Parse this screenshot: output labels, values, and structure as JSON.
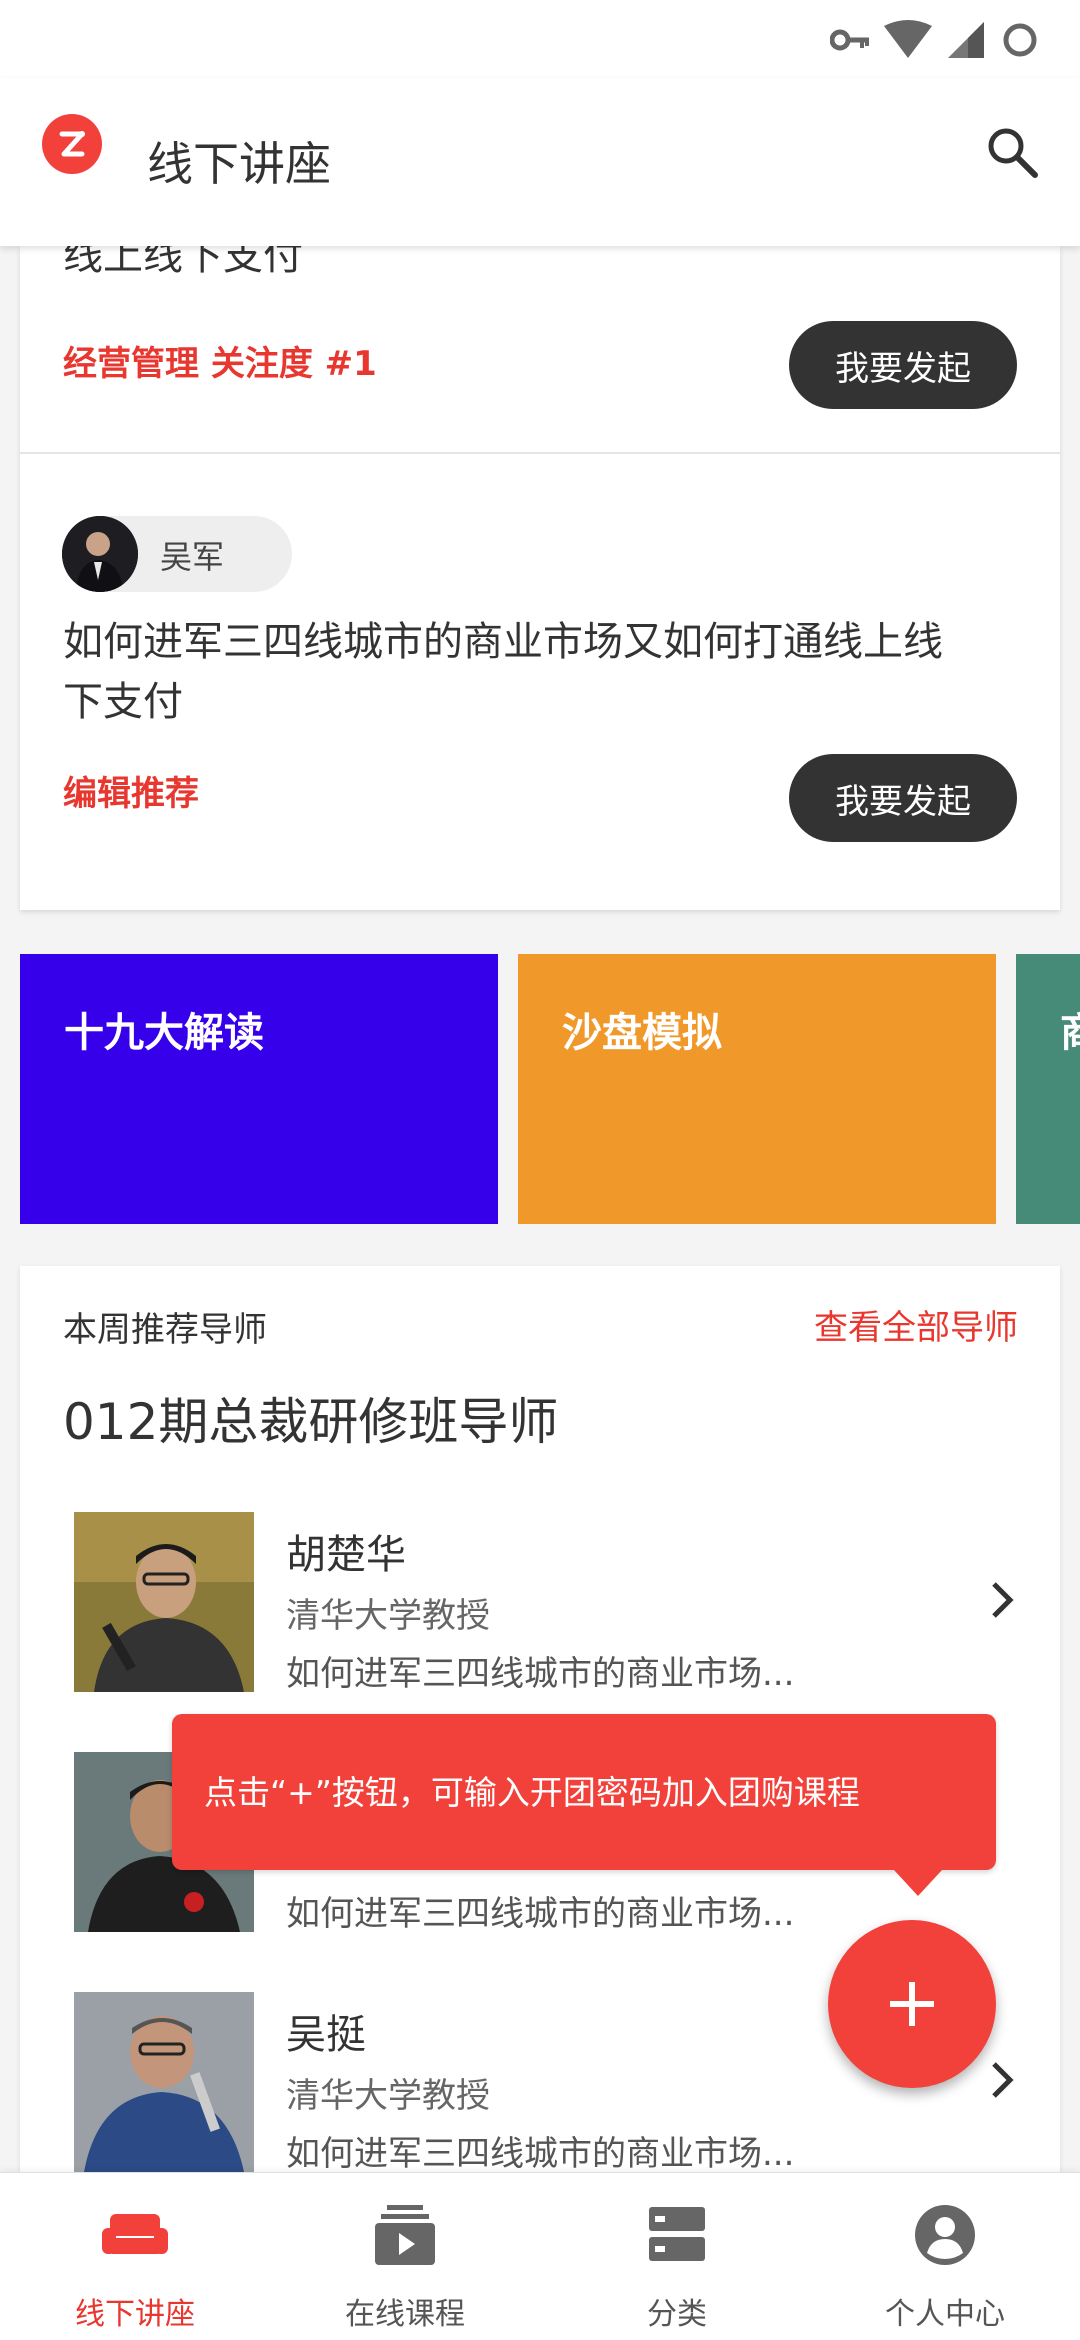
{
  "app": {
    "title": "线下讲座"
  },
  "top_card": {
    "clipped_text": "线上线下支付",
    "tag": "经营管理 关注度 #1",
    "action_label": "我要发起"
  },
  "post": {
    "author": "吴军",
    "title": "如何进军三四线城市的商业市场又如何打通线上线下支付",
    "tag": "编辑推荐",
    "action_label": "我要发起"
  },
  "categories": [
    {
      "label": "十九大解读",
      "color": "#3700ea"
    },
    {
      "label": "沙盘模拟",
      "color": "#f0992a"
    },
    {
      "label": "商",
      "color": "#468a78"
    }
  ],
  "mentors": {
    "section_label": "本周推荐导师",
    "view_all": "查看全部导师",
    "title": "012期总裁研修班导师",
    "items": [
      {
        "name": "胡楚华",
        "subtitle": "清华大学教授",
        "desc": "如何进军三四线城市的商业市场..."
      },
      {
        "name": "",
        "subtitle": "",
        "desc": "如何进军三四线城市的商业市场..."
      },
      {
        "name": "吴挺",
        "subtitle": "清华大学教授",
        "desc": "如何进军三四线城市的商业市场..."
      }
    ]
  },
  "tooltip": {
    "text": "点击“+”按钮，可输入开团密码加入团购课程"
  },
  "fab": {
    "icon": "plus-icon"
  },
  "bottom_nav": [
    {
      "label": "线下讲座",
      "icon": "sofa-icon",
      "active": true
    },
    {
      "label": "在线课程",
      "icon": "video-stack-icon",
      "active": false
    },
    {
      "label": "分类",
      "icon": "storage-icon",
      "active": false
    },
    {
      "label": "个人中心",
      "icon": "account-icon",
      "active": false
    }
  ],
  "colors": {
    "accent": "#e8372f",
    "fab": "#f2413a",
    "button_dark": "#333333"
  }
}
